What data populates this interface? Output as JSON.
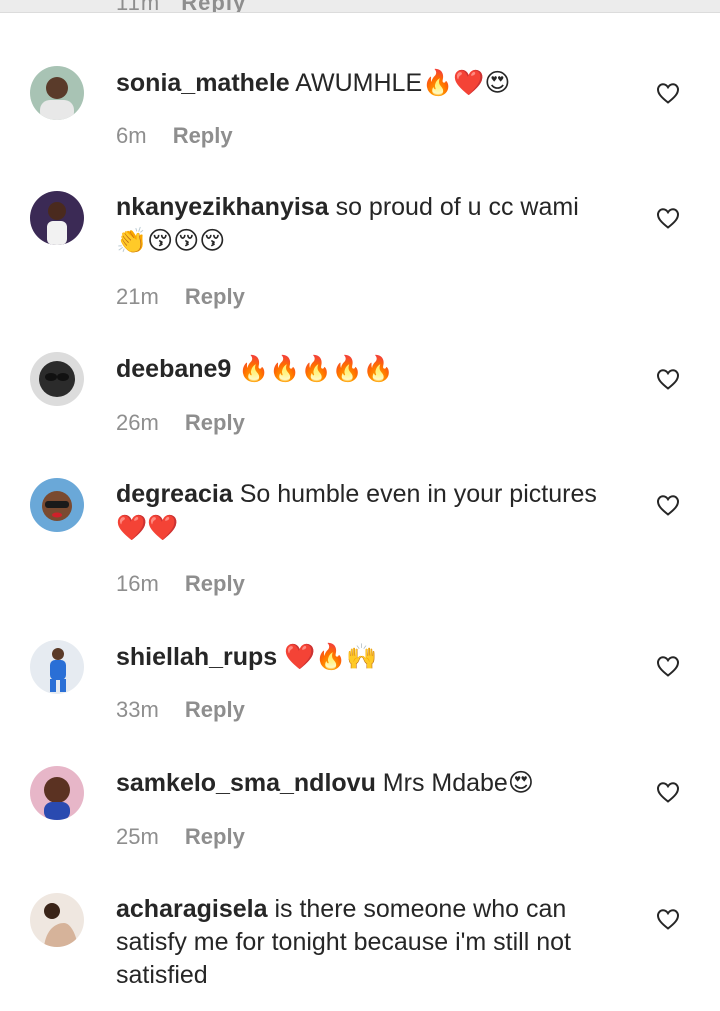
{
  "partial_row": {
    "time": "11m",
    "reply": "Reply"
  },
  "comments": [
    {
      "username": "sonia_mathele",
      "text": "AWUMHLE",
      "emoji": "🔥❤️😍",
      "time": "6m",
      "reply": "Reply",
      "avatar_color": "#9fb8a8"
    },
    {
      "username": "nkanyezikhanyisa",
      "text": "so proud of u cc wami",
      "emoji": "👏😚😚😚",
      "time": "21m",
      "reply": "Reply",
      "avatar_color": "#3a2f5a"
    },
    {
      "username": "deebane9",
      "text": "",
      "emoji": "🔥🔥🔥🔥🔥",
      "time": "26m",
      "reply": "Reply",
      "avatar_color": "#2b2b2b"
    },
    {
      "username": "degreacia",
      "text": "So humble even in your pictures",
      "emoji": "❤️❤️",
      "time": "16m",
      "reply": "Reply",
      "avatar_color": "#6aa8d8"
    },
    {
      "username": "shiellah_rups",
      "text": "",
      "emoji": "❤️🔥🙌",
      "time": "33m",
      "reply": "Reply",
      "avatar_color": "#dfe6ef"
    },
    {
      "username": "samkelo_sma_ndlovu",
      "text": "Mrs Mdabe",
      "emoji": "😍",
      "time": "25m",
      "reply": "Reply",
      "avatar_color": "#c98aa8"
    },
    {
      "username": "acharagisela",
      "text": "is there someone who can satisfy me for tonight because i'm still not satisfied",
      "emoji": "",
      "time": "",
      "reply": "",
      "avatar_color": "#d9c2b0"
    }
  ],
  "icons": {
    "like": "heart-outline-icon"
  },
  "colors": {
    "text": "#262626",
    "muted": "#8e8e8e",
    "background": "#ffffff"
  }
}
